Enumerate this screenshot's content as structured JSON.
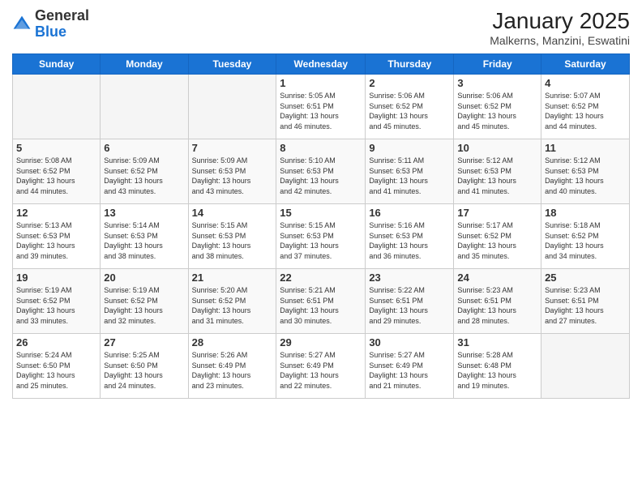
{
  "logo": {
    "general": "General",
    "blue": "Blue"
  },
  "header": {
    "month": "January 2025",
    "location": "Malkerns, Manzini, Eswatini"
  },
  "days_of_week": [
    "Sunday",
    "Monday",
    "Tuesday",
    "Wednesday",
    "Thursday",
    "Friday",
    "Saturday"
  ],
  "weeks": [
    [
      {
        "day": "",
        "data": ""
      },
      {
        "day": "",
        "data": ""
      },
      {
        "day": "",
        "data": ""
      },
      {
        "day": "1",
        "data": "Sunrise: 5:05 AM\nSunset: 6:51 PM\nDaylight: 13 hours\nand 46 minutes."
      },
      {
        "day": "2",
        "data": "Sunrise: 5:06 AM\nSunset: 6:52 PM\nDaylight: 13 hours\nand 45 minutes."
      },
      {
        "day": "3",
        "data": "Sunrise: 5:06 AM\nSunset: 6:52 PM\nDaylight: 13 hours\nand 45 minutes."
      },
      {
        "day": "4",
        "data": "Sunrise: 5:07 AM\nSunset: 6:52 PM\nDaylight: 13 hours\nand 44 minutes."
      }
    ],
    [
      {
        "day": "5",
        "data": "Sunrise: 5:08 AM\nSunset: 6:52 PM\nDaylight: 13 hours\nand 44 minutes."
      },
      {
        "day": "6",
        "data": "Sunrise: 5:09 AM\nSunset: 6:52 PM\nDaylight: 13 hours\nand 43 minutes."
      },
      {
        "day": "7",
        "data": "Sunrise: 5:09 AM\nSunset: 6:53 PM\nDaylight: 13 hours\nand 43 minutes."
      },
      {
        "day": "8",
        "data": "Sunrise: 5:10 AM\nSunset: 6:53 PM\nDaylight: 13 hours\nand 42 minutes."
      },
      {
        "day": "9",
        "data": "Sunrise: 5:11 AM\nSunset: 6:53 PM\nDaylight: 13 hours\nand 41 minutes."
      },
      {
        "day": "10",
        "data": "Sunrise: 5:12 AM\nSunset: 6:53 PM\nDaylight: 13 hours\nand 41 minutes."
      },
      {
        "day": "11",
        "data": "Sunrise: 5:12 AM\nSunset: 6:53 PM\nDaylight: 13 hours\nand 40 minutes."
      }
    ],
    [
      {
        "day": "12",
        "data": "Sunrise: 5:13 AM\nSunset: 6:53 PM\nDaylight: 13 hours\nand 39 minutes."
      },
      {
        "day": "13",
        "data": "Sunrise: 5:14 AM\nSunset: 6:53 PM\nDaylight: 13 hours\nand 38 minutes."
      },
      {
        "day": "14",
        "data": "Sunrise: 5:15 AM\nSunset: 6:53 PM\nDaylight: 13 hours\nand 38 minutes."
      },
      {
        "day": "15",
        "data": "Sunrise: 5:15 AM\nSunset: 6:53 PM\nDaylight: 13 hours\nand 37 minutes."
      },
      {
        "day": "16",
        "data": "Sunrise: 5:16 AM\nSunset: 6:53 PM\nDaylight: 13 hours\nand 36 minutes."
      },
      {
        "day": "17",
        "data": "Sunrise: 5:17 AM\nSunset: 6:52 PM\nDaylight: 13 hours\nand 35 minutes."
      },
      {
        "day": "18",
        "data": "Sunrise: 5:18 AM\nSunset: 6:52 PM\nDaylight: 13 hours\nand 34 minutes."
      }
    ],
    [
      {
        "day": "19",
        "data": "Sunrise: 5:19 AM\nSunset: 6:52 PM\nDaylight: 13 hours\nand 33 minutes."
      },
      {
        "day": "20",
        "data": "Sunrise: 5:19 AM\nSunset: 6:52 PM\nDaylight: 13 hours\nand 32 minutes."
      },
      {
        "day": "21",
        "data": "Sunrise: 5:20 AM\nSunset: 6:52 PM\nDaylight: 13 hours\nand 31 minutes."
      },
      {
        "day": "22",
        "data": "Sunrise: 5:21 AM\nSunset: 6:51 PM\nDaylight: 13 hours\nand 30 minutes."
      },
      {
        "day": "23",
        "data": "Sunrise: 5:22 AM\nSunset: 6:51 PM\nDaylight: 13 hours\nand 29 minutes."
      },
      {
        "day": "24",
        "data": "Sunrise: 5:23 AM\nSunset: 6:51 PM\nDaylight: 13 hours\nand 28 minutes."
      },
      {
        "day": "25",
        "data": "Sunrise: 5:23 AM\nSunset: 6:51 PM\nDaylight: 13 hours\nand 27 minutes."
      }
    ],
    [
      {
        "day": "26",
        "data": "Sunrise: 5:24 AM\nSunset: 6:50 PM\nDaylight: 13 hours\nand 25 minutes."
      },
      {
        "day": "27",
        "data": "Sunrise: 5:25 AM\nSunset: 6:50 PM\nDaylight: 13 hours\nand 24 minutes."
      },
      {
        "day": "28",
        "data": "Sunrise: 5:26 AM\nSunset: 6:49 PM\nDaylight: 13 hours\nand 23 minutes."
      },
      {
        "day": "29",
        "data": "Sunrise: 5:27 AM\nSunset: 6:49 PM\nDaylight: 13 hours\nand 22 minutes."
      },
      {
        "day": "30",
        "data": "Sunrise: 5:27 AM\nSunset: 6:49 PM\nDaylight: 13 hours\nand 21 minutes."
      },
      {
        "day": "31",
        "data": "Sunrise: 5:28 AM\nSunset: 6:48 PM\nDaylight: 13 hours\nand 19 minutes."
      },
      {
        "day": "",
        "data": ""
      }
    ]
  ]
}
